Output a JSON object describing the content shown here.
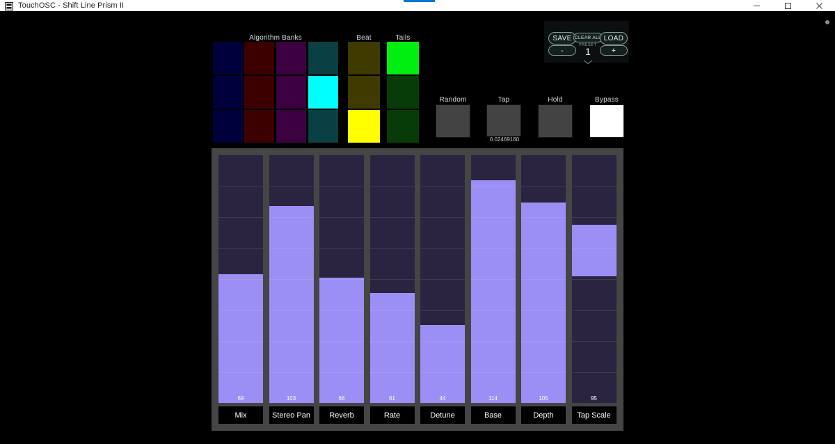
{
  "window": {
    "title": "TouchOSC - Shift Line Prism II",
    "icon": "app-window-icon",
    "minimize_label": "minimize-icon",
    "maximize_label": "maximize-icon",
    "close_label": "close-icon",
    "accent_color": "#0078d4"
  },
  "sections": {
    "algorithm_banks_label": "Algorithm Banks",
    "beat_label": "Beat",
    "tails_label": "Tails"
  },
  "algorithm_banks": {
    "columns": 4,
    "rows": 3,
    "colors": {
      "col1_off": "#00003c",
      "col2_off": "#3c0000",
      "col3_off": "#3c0040",
      "col4_off": "#0a3f44",
      "col4_on": "#00ffff"
    },
    "cells": [
      [
        {
          "col": 1,
          "state": "off"
        },
        {
          "col": 2,
          "state": "off"
        },
        {
          "col": 3,
          "state": "off"
        },
        {
          "col": 4,
          "state": "off"
        }
      ],
      [
        {
          "col": 1,
          "state": "off"
        },
        {
          "col": 2,
          "state": "off"
        },
        {
          "col": 3,
          "state": "off"
        },
        {
          "col": 4,
          "state": "on"
        }
      ],
      [
        {
          "col": 1,
          "state": "off"
        },
        {
          "col": 2,
          "state": "off"
        },
        {
          "col": 3,
          "state": "off"
        },
        {
          "col": 4,
          "state": "off"
        }
      ]
    ]
  },
  "beat_column": {
    "off_color": "#3f3a00",
    "on_color": "#ffff00",
    "cells": [
      "off",
      "off",
      "on"
    ]
  },
  "tails_column": {
    "off_color": "#073b07",
    "on_color": "#00ef11",
    "cells": [
      "on",
      "off",
      "off"
    ]
  },
  "actions": [
    {
      "label": "Random",
      "state": "off"
    },
    {
      "label": "Tap",
      "state": "off"
    },
    {
      "label": "Hold",
      "state": "off"
    },
    {
      "label": "Bypass",
      "state": "on"
    }
  ],
  "tap_readout": "0.02469160",
  "preset": {
    "save_label": "SAVE",
    "load_label": "LOAD",
    "clear_all_label": "CLEAR ALL",
    "preset_caption": "PRESET",
    "value": "1",
    "minus_label": "-",
    "plus_label": "+",
    "chevron": "chevron-down-icon"
  },
  "faders": {
    "max": 127,
    "track_color": "#2b2440",
    "fill_color": "#9b8ef5",
    "items": [
      {
        "label": "Mix",
        "value": 69,
        "fill_top_pct": 48.0,
        "fill_bottom_pct": 0
      },
      {
        "label": "Stereo Pan",
        "value": 103,
        "fill_top_pct": 20.5,
        "fill_bottom_pct": 0
      },
      {
        "label": "Reverb",
        "value": 66,
        "fill_top_pct": 49.5,
        "fill_bottom_pct": 0
      },
      {
        "label": "Rate",
        "value": 61,
        "fill_top_pct": 55.5,
        "fill_bottom_pct": 0
      },
      {
        "label": "Detune",
        "value": 44,
        "fill_top_pct": 68.5,
        "fill_bottom_pct": 0
      },
      {
        "label": "Base",
        "value": 114,
        "fill_top_pct": 10.0,
        "fill_bottom_pct": 0
      },
      {
        "label": "Depth",
        "value": 105,
        "fill_top_pct": 19.0,
        "fill_bottom_pct": 0
      },
      {
        "label": "Tap Scale",
        "value": 95,
        "fill_top_pct": 28.0,
        "fill_bottom_pct": 51.0
      }
    ]
  }
}
